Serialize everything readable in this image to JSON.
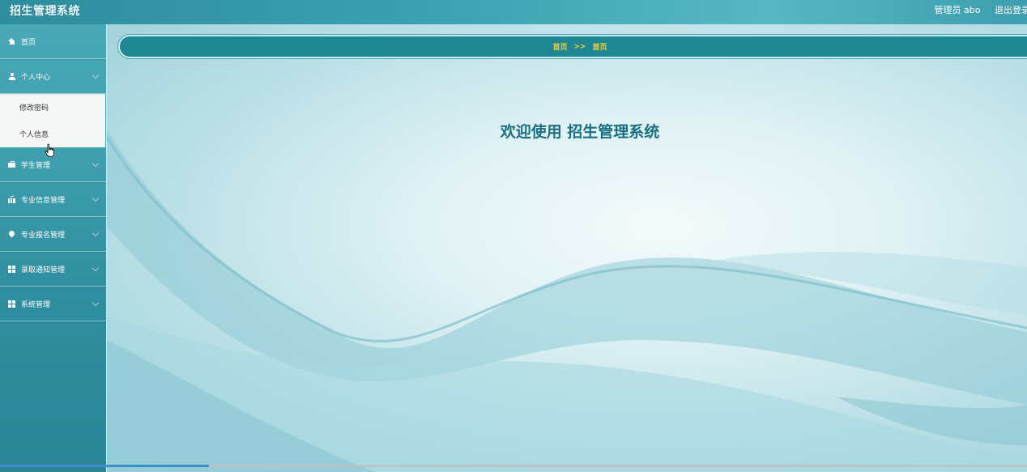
{
  "header": {
    "title": "招生管理系统",
    "user_label": "管理员 abo",
    "logout_label": "退出登录"
  },
  "sidebar": {
    "items": [
      {
        "label": "首页",
        "icon": "home-icon"
      },
      {
        "label": "个人中心",
        "icon": "user-icon"
      },
      {
        "label": "学生管理",
        "icon": "briefcase-icon"
      },
      {
        "label": "专业信息管理",
        "icon": "chart-icon"
      },
      {
        "label": "专业报名管理",
        "icon": "pin-icon"
      },
      {
        "label": "录取通知管理",
        "icon": "grid-icon"
      },
      {
        "label": "系统管理",
        "icon": "grid-icon"
      }
    ],
    "submenu": [
      "修改密码",
      "个人信息"
    ]
  },
  "breadcrumb": {
    "home": "首页",
    "separator": ">>",
    "current": "首页"
  },
  "main": {
    "welcome": "欢迎使用 招生管理系统"
  },
  "colors": {
    "header": "#3aa0b0",
    "sidebar": "#3f9fae",
    "breadcrumb_bg": "#1f8794",
    "breadcrumb_text": "#f0d23a",
    "welcome_text": "#1b6f82"
  }
}
